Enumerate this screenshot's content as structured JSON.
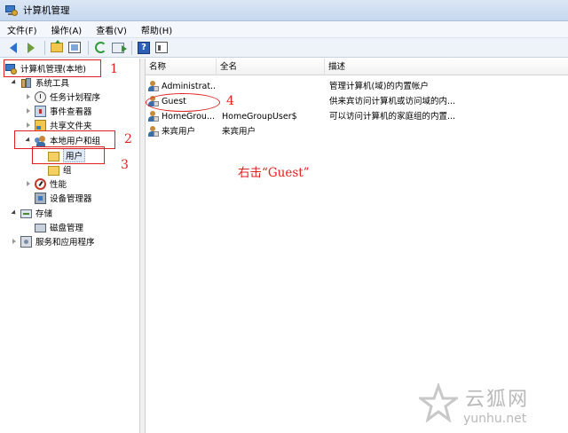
{
  "window": {
    "title": "计算机管理"
  },
  "menu": [
    "文件(F)",
    "操作(A)",
    "查看(V)",
    "帮助(H)"
  ],
  "toolbar": {
    "buttons": [
      "back-arrow-icon",
      "forward-arrow-icon",
      "up-folder-icon",
      "show-hide-tree-icon",
      "refresh-icon",
      "export-list-icon",
      "help-icon",
      "action-pane-icon"
    ]
  },
  "tree": {
    "items": [
      {
        "label": "计算机管理(本地)"
      },
      {
        "label": "系统工具"
      },
      {
        "label": "任务计划程序"
      },
      {
        "label": "事件查看器"
      },
      {
        "label": "共享文件夹"
      },
      {
        "label": "本地用户和组"
      },
      {
        "label": "用户"
      },
      {
        "label": "组"
      },
      {
        "label": "性能"
      },
      {
        "label": "设备管理器"
      },
      {
        "label": "存储"
      },
      {
        "label": "磁盘管理"
      },
      {
        "label": "服务和应用程序"
      }
    ]
  },
  "list": {
    "columns": [
      "名称",
      "全名",
      "描述"
    ],
    "rows": [
      {
        "name": "Administrat...",
        "fullname": "",
        "desc": "管理计算机(域)的内置帐户"
      },
      {
        "name": "Guest",
        "fullname": "",
        "desc": "供来宾访问计算机或访问域的内..."
      },
      {
        "name": "HomeGrou...",
        "fullname": "HomeGroupUser$",
        "desc": "可以访问计算机的家庭组的内置..."
      },
      {
        "name": "来宾用户",
        "fullname": "来宾用户",
        "desc": ""
      }
    ]
  },
  "annotations": {
    "n1": "1",
    "n2": "2",
    "n3": "3",
    "n4": "4",
    "note": "右击“Guest”",
    "color": "#e02020"
  },
  "watermark": {
    "brand": "云狐网",
    "url": "yunhu.net"
  }
}
